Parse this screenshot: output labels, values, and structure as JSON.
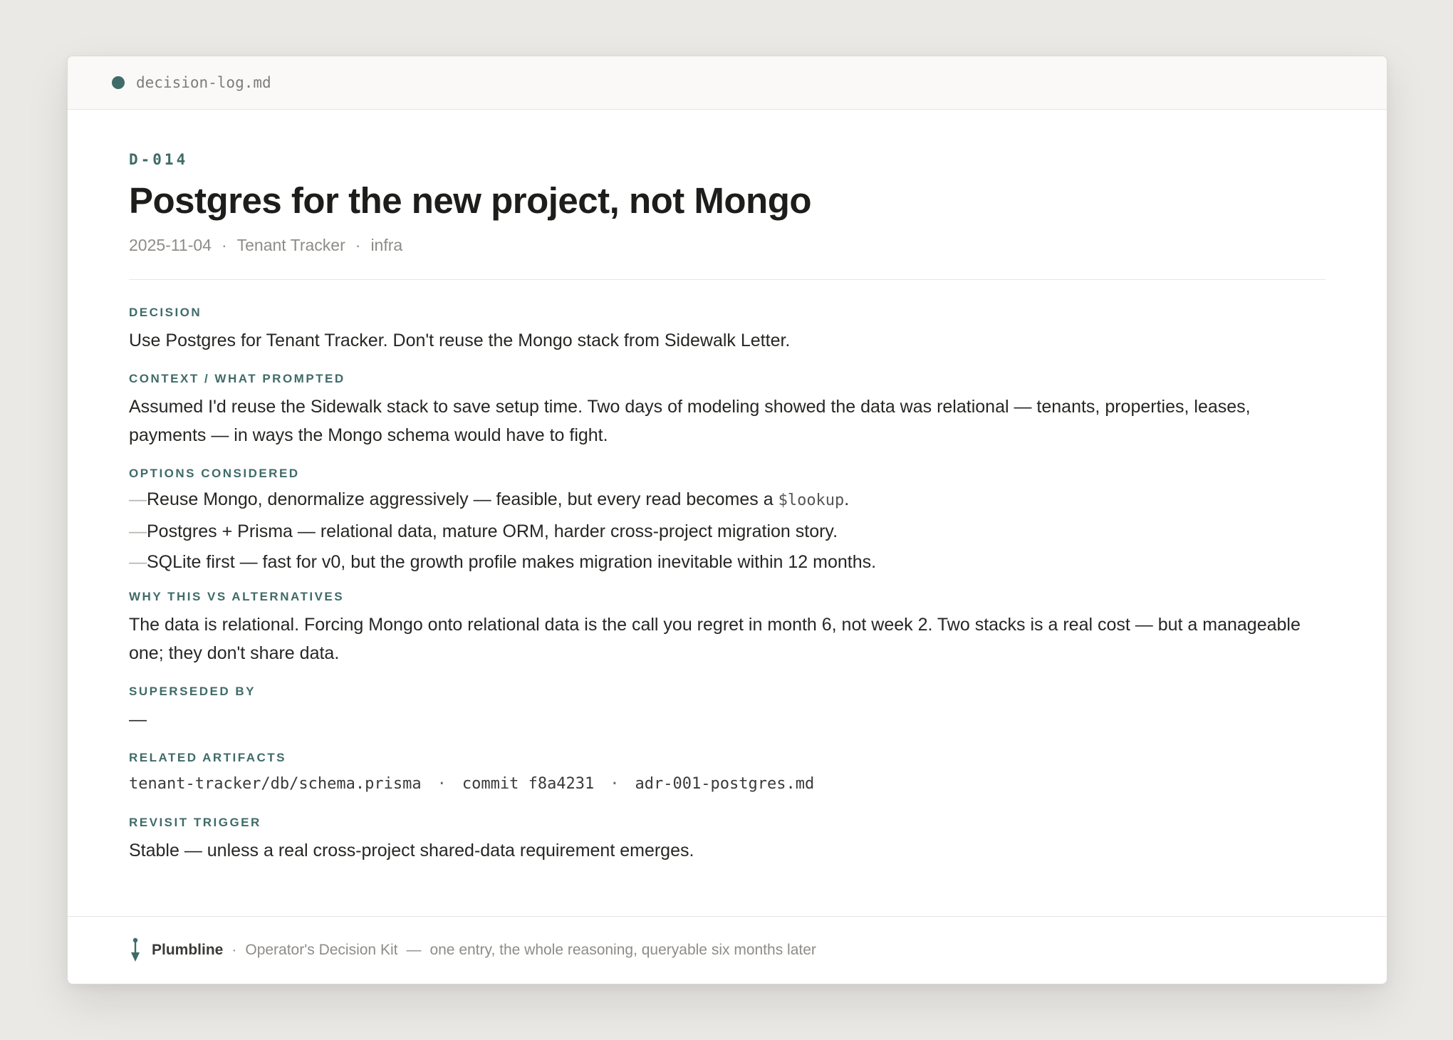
{
  "window": {
    "filename": "decision-log.md"
  },
  "entry": {
    "id": "D-014",
    "title": "Postgres for the new project, not Mongo",
    "meta": {
      "date": "2025-11-04",
      "project": "Tenant Tracker",
      "tag": "infra",
      "separator": "·"
    },
    "sections": {
      "decision": {
        "label": "DECISION",
        "text": "Use Postgres for Tenant Tracker. Don't reuse the Mongo stack from Sidewalk Letter."
      },
      "context": {
        "label": "CONTEXT / WHAT PROMPTED",
        "text": "Assumed I'd reuse the Sidewalk stack to save setup time. Two days of modeling showed the data was relational — tenants, properties, leases, payments — in ways the Mongo schema would have to fight."
      },
      "options": {
        "label": "OPTIONS CONSIDERED",
        "dash": "—",
        "items": [
          {
            "text": "Reuse Mongo, denormalize aggressively — feasible, but every read becomes a ",
            "code": "$lookup",
            "suffix": "."
          },
          {
            "text": "Postgres + Prisma — relational data, mature ORM, harder cross-project migration story."
          },
          {
            "text": "SQLite first — fast for v0, but the growth profile makes migration inevitable within 12 months."
          }
        ]
      },
      "why": {
        "label": "WHY THIS VS ALTERNATIVES",
        "text": "The data is relational. Forcing Mongo onto relational data is the call you regret in month 6, not week 2. Two stacks is a real cost — but a manageable one; they don't share data."
      },
      "superseded": {
        "label": "SUPERSEDED BY",
        "text": "—"
      },
      "artifacts": {
        "label": "RELATED ARTIFACTS",
        "items": [
          "tenant-tracker/db/schema.prisma",
          "commit f8a4231",
          "adr-001-postgres.md"
        ],
        "separator": "·"
      },
      "revisit": {
        "label": "REVISIT TRIGGER",
        "text": "Stable — unless a real cross-project shared-data requirement emerges."
      }
    }
  },
  "footer": {
    "brand": "Plumbline",
    "separator": "·",
    "product": "Operator's Decision Kit",
    "dash": "—",
    "tagline": "one entry, the whole reasoning, queryable six months later",
    "icon": "plumb-bob-icon"
  },
  "colors": {
    "accent": "#3f6b68",
    "background": "#eae9e5",
    "text": "#262624",
    "muted": "#8e8c88"
  }
}
